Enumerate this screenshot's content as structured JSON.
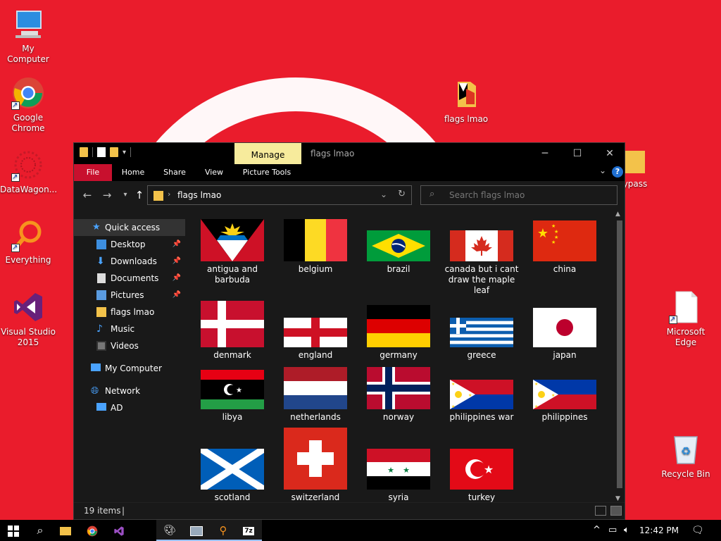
{
  "desktop": {
    "icons": [
      {
        "label": "My Computer",
        "name": "my-computer"
      },
      {
        "label": "Google Chrome",
        "name": "google-chrome"
      },
      {
        "label": "DataWagon...",
        "name": "datawagon"
      },
      {
        "label": "Everything",
        "name": "everything"
      },
      {
        "label": "Visual Studio 2015",
        "name": "visual-studio-2015"
      },
      {
        "label": "flags lmao",
        "name": "flags-lmao"
      },
      {
        "label": "ypass",
        "name": "ypass"
      },
      {
        "label": "Microsoft Edge",
        "name": "microsoft-edge"
      },
      {
        "label": "Recycle Bin",
        "name": "recycle-bin"
      }
    ]
  },
  "window": {
    "title": "flags lmao",
    "manage_tab": "Manage",
    "ribbon_tabs": [
      "File",
      "Home",
      "Share",
      "View",
      "Picture Tools"
    ],
    "help": "?",
    "address": {
      "crumb": "›",
      "path": "flags lmao"
    },
    "search_placeholder": "Search flags lmao",
    "nav": [
      {
        "label": "Quick access",
        "icon": "star-icon"
      },
      {
        "label": "Desktop",
        "icon": "desktop-icon",
        "pinned": true
      },
      {
        "label": "Downloads",
        "icon": "download-icon",
        "pinned": true
      },
      {
        "label": "Documents",
        "icon": "documents-icon",
        "pinned": true
      },
      {
        "label": "Pictures",
        "icon": "pictures-icon",
        "pinned": true
      },
      {
        "label": "flags lmao",
        "icon": "folder-icon"
      },
      {
        "label": "Music",
        "icon": "music-icon"
      },
      {
        "label": "Videos",
        "icon": "videos-icon"
      },
      {
        "label": "My Computer",
        "icon": "computer-icon"
      },
      {
        "label": "Network",
        "icon": "network-icon"
      },
      {
        "label": "AD",
        "icon": "monitor-icon"
      }
    ],
    "files": [
      {
        "label": "antigua and barbuda",
        "flag": "antigua"
      },
      {
        "label": "belgium",
        "flag": "belgium"
      },
      {
        "label": "brazil",
        "flag": "brazil"
      },
      {
        "label": "canada but i cant draw the maple leaf",
        "flag": "canada"
      },
      {
        "label": "china",
        "flag": "china"
      },
      {
        "label": "denmark",
        "flag": "denmark"
      },
      {
        "label": "england",
        "flag": "england"
      },
      {
        "label": "germany",
        "flag": "germany"
      },
      {
        "label": "greece",
        "flag": "greece"
      },
      {
        "label": "japan",
        "flag": "japan"
      },
      {
        "label": "libya",
        "flag": "libya"
      },
      {
        "label": "netherlands",
        "flag": "netherlands"
      },
      {
        "label": "norway",
        "flag": "norway"
      },
      {
        "label": "philippines war",
        "flag": "philippines-war"
      },
      {
        "label": "philippines",
        "flag": "philippines"
      },
      {
        "label": "scotland",
        "flag": "scotland"
      },
      {
        "label": "switzerland",
        "flag": "switzerland"
      },
      {
        "label": "syria",
        "flag": "syria"
      },
      {
        "label": "turkey",
        "flag": "turkey"
      }
    ],
    "status": {
      "count": "19 items",
      "sep": "|"
    }
  },
  "taskbar": {
    "clock": "12:42 PM",
    "apps": [
      "start",
      "search",
      "file-explorer",
      "chrome",
      "visual-studio",
      "paint",
      "photos",
      "everything",
      "7zip"
    ]
  },
  "colors": {
    "desktop": "#ea1c2c",
    "file_tab": "#c8102e",
    "manage": "#f7eb9c"
  }
}
